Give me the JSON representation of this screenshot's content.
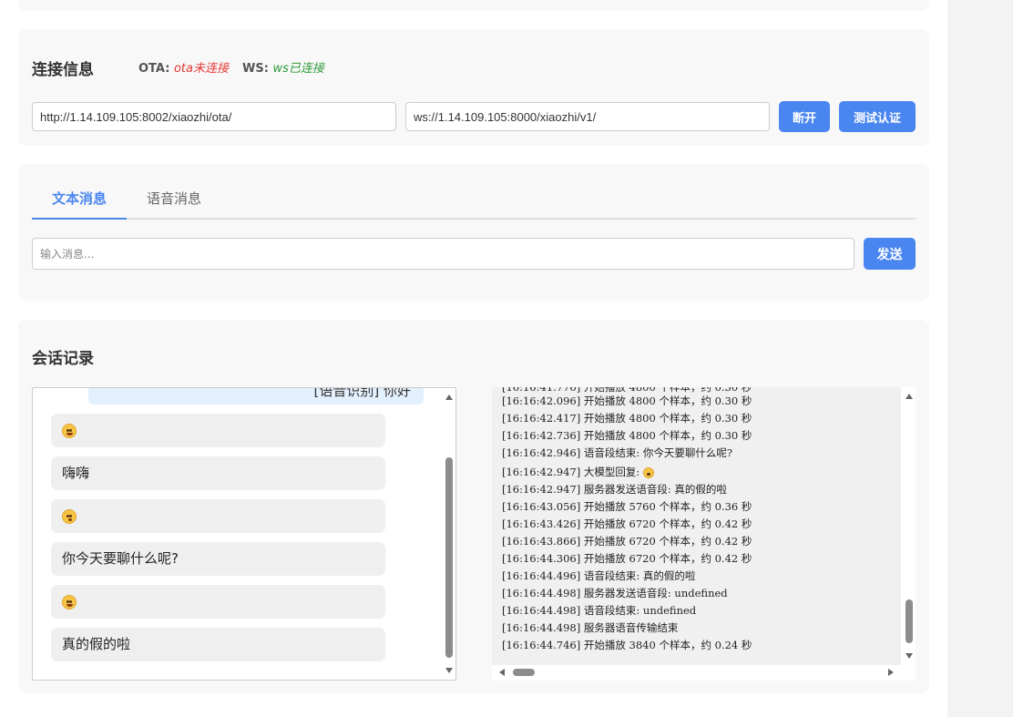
{
  "connection": {
    "title": "连接信息",
    "ota_label": "OTA:",
    "ota_status": "ota未连接",
    "ws_label": "WS:",
    "ws_status": "ws已连接",
    "ota_url": "http://1.14.109.105:8002/xiaozhi/ota/",
    "ws_url": "ws://1.14.109.105:8000/xiaozhi/v1/",
    "disconnect_label": "断开",
    "auth_label": "测试认证"
  },
  "messaging": {
    "tabs": [
      "文本消息",
      "语音消息"
    ],
    "active_tab": 0,
    "input_placeholder": "输入消息...",
    "send_label": "发送"
  },
  "conversation": {
    "title": "会话记录",
    "partial_message": "[语音识别] 你好",
    "messages": [
      {
        "type": "emoji",
        "emoji": "smile"
      },
      {
        "type": "text",
        "text": "嗨嗨"
      },
      {
        "type": "emoji",
        "emoji": "thinking"
      },
      {
        "type": "text",
        "text": "你今天要聊什么呢?"
      },
      {
        "type": "emoji",
        "emoji": "smile"
      },
      {
        "type": "text",
        "text": "真的假的啦"
      }
    ],
    "log": [
      "[16:16:42.096] 开始播放 4800 个样本，约 0.30 秒",
      "[16:16:42.417] 开始播放 4800 个样本，约 0.30 秒",
      "[16:16:42.736] 开始播放 4800 个样本，约 0.30 秒",
      "[16:16:42.946] 语音段结束: 你今天要聊什么呢?",
      "[16:16:42.947] 大模型回复: ",
      "[16:16:42.947] 服务器发送语音段: 真的假的啦",
      "[16:16:43.056] 开始播放 5760 个样本，约 0.36 秒",
      "[16:16:43.426] 开始播放 6720 个样本，约 0.42 秒",
      "[16:16:43.866] 开始播放 6720 个样本，约 0.42 秒",
      "[16:16:44.306] 开始播放 6720 个样本，约 0.42 秒",
      "[16:16:44.496] 语音段结束: 真的假的啦",
      "[16:16:44.498] 服务器发送语音段: undefined",
      "[16:16:44.498] 语音段结束: undefined",
      "[16:16:44.498] 服务器语音传输结束",
      "[16:16:44.746] 开始播放 3840 个样本，约 0.24 秒"
    ]
  }
}
